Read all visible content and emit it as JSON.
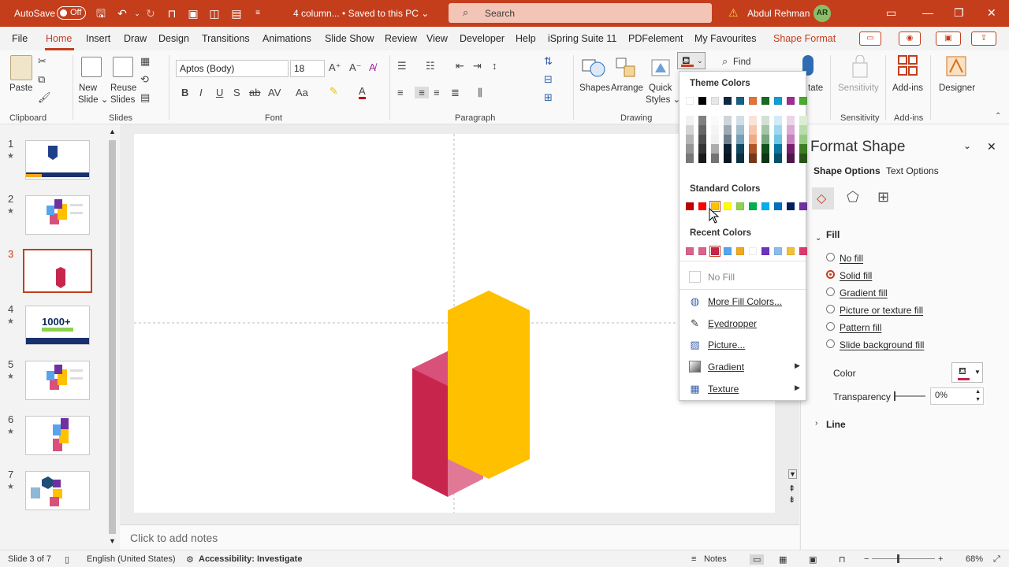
{
  "titlebar": {
    "autosave_label": "AutoSave",
    "autosave_state": "Off",
    "document": "4 column... • Saved to this PC ⌄",
    "search_placeholder": "Search",
    "user_name": "Abdul Rehman",
    "user_initials": "AR"
  },
  "menu": {
    "file": "File",
    "home": "Home",
    "insert": "Insert",
    "draw": "Draw",
    "design": "Design",
    "transitions": "Transitions",
    "animations": "Animations",
    "slideshow": "Slide Show",
    "review": "Review",
    "view": "View",
    "developer": "Developer",
    "help": "Help",
    "ispring": "iSpring Suite 11",
    "pdfelement": "PDFelement",
    "favourites": "My Favourites",
    "shape_format": "Shape Format"
  },
  "ribbon": {
    "paste": "Paste",
    "clipboard": "Clipboard",
    "new_slide_1": "New",
    "new_slide_2": "Slide ⌄",
    "reuse_1": "Reuse",
    "reuse_2": "Slides",
    "slides": "Slides",
    "font_name": "Aptos (Body)",
    "font_size": "18",
    "font": "Font",
    "paragraph": "Paragraph",
    "shapes": "Shapes",
    "arrange": "Arrange",
    "quick_styles_1": "Quick",
    "quick_styles_2": "Styles ⌄",
    "drawing": "Drawing",
    "find": "Find",
    "dictate": "tate",
    "sensitivity": "Sensitivity",
    "sensitivity_group": "Sensitivity",
    "addins": "Add-ins",
    "addins_group": "Add-ins",
    "designer": "Designer"
  },
  "thumbnails": [
    {
      "num": "1",
      "star": "★"
    },
    {
      "num": "2",
      "star": "★"
    },
    {
      "num": "3",
      "star": ""
    },
    {
      "num": "4",
      "star": "★"
    },
    {
      "num": "5",
      "star": "★"
    },
    {
      "num": "6",
      "star": "★"
    },
    {
      "num": "7",
      "star": "★"
    }
  ],
  "thumb4_text": "1000+",
  "notes_placeholder": "Click to add notes",
  "format_pane": {
    "title": "Format Shape",
    "tab_shape": "Shape Options",
    "tab_text": "Text Options",
    "fill_section": "Fill",
    "options": [
      "No fill",
      "Solid fill",
      "Gradient fill",
      "Picture or texture fill",
      "Pattern fill",
      "Slide background fill"
    ],
    "selected_option": "Solid fill",
    "color_label": "Color",
    "transparency_label": "Transparency",
    "transparency_value": "0%",
    "line_section": "Line"
  },
  "dropdown": {
    "theme_colors": "Theme Colors",
    "standard_colors": "Standard Colors",
    "recent_colors": "Recent Colors",
    "no_fill": "No Fill",
    "more_colors": "More Fill Colors...",
    "eyedropper": "Eyedropper",
    "picture": "Picture...",
    "gradient": "Gradient",
    "texture": "Texture",
    "theme_top": [
      "#ffffff",
      "#000000",
      "#e7e6e6",
      "#0e2841",
      "#156082",
      "#e97132",
      "#196b24",
      "#0f9ed5",
      "#a02b93",
      "#4ea72e"
    ],
    "standard": [
      "#c00000",
      "#ff0000",
      "#ffc000",
      "#ffff00",
      "#92d050",
      "#00b050",
      "#00b0f0",
      "#0070c0",
      "#002060",
      "#7030a0"
    ],
    "recent": [
      "#d9638a",
      "#d9638a",
      "#c8254d",
      "#56a5ec",
      "#f4a81d",
      "#ffffff",
      "#7030c0",
      "#8bbcf0",
      "#f2c037",
      "#d93b6d"
    ]
  },
  "statusbar": {
    "slide_info": "Slide 3 of 7",
    "language": "English (United States)",
    "accessibility": "Accessibility: Investigate",
    "notes": "Notes",
    "zoom": "68%"
  },
  "shape_colors": {
    "yellow": "#ffc000",
    "crimson_dark": "#c8254d",
    "crimson_top": "#d9507a",
    "crimson_side": "#e07896"
  }
}
